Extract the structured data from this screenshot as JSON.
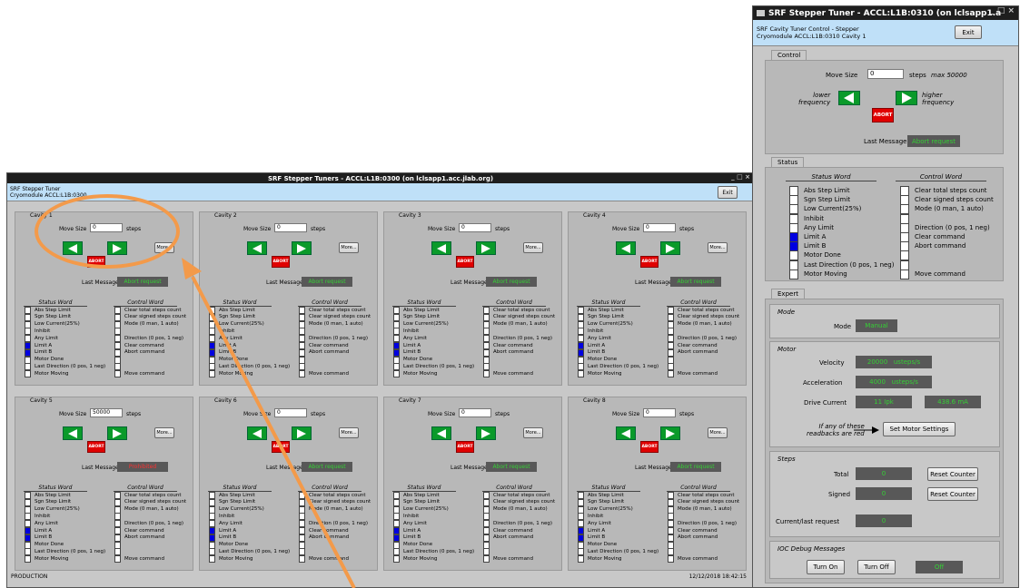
{
  "main_window": {
    "title": "SRF Stepper Tuners - ACCL:L1B:0300 (on lclsapp1.acc.jlab.org)",
    "header_line1": "SRF Stepper Tuner",
    "header_line2": "Cryomodule ACCL:L1B:0300",
    "exit_label": "Exit",
    "footer_left": "PRODUCTION",
    "footer_right": "12/12/2018 18:42:15",
    "window_controls": "_ □ ×",
    "cavities": [
      {
        "name": "Cavity 1",
        "move_size": "0",
        "message": "Abort request",
        "message_state": "ok"
      },
      {
        "name": "Cavity 2",
        "move_size": "0",
        "message": "Abort request",
        "message_state": "ok"
      },
      {
        "name": "Cavity 3",
        "move_size": "0",
        "message": "Abort request",
        "message_state": "ok"
      },
      {
        "name": "Cavity 4",
        "move_size": "0",
        "message": "Abort request",
        "message_state": "ok"
      },
      {
        "name": "Cavity 5",
        "move_size": "50000",
        "message": "Prohibited",
        "message_state": "alarm"
      },
      {
        "name": "Cavity 6",
        "move_size": "0",
        "message": "Abort request",
        "message_state": "ok"
      },
      {
        "name": "Cavity 7",
        "move_size": "0",
        "message": "Abort request",
        "message_state": "ok"
      },
      {
        "name": "Cavity 8",
        "move_size": "0",
        "message": "Abort request",
        "message_state": "ok"
      }
    ]
  },
  "cavity_labels": {
    "move_size": "Move Size",
    "steps": "steps",
    "more": "More...",
    "abort": "ABORT",
    "last_message": "Last Message",
    "status_word": "Status Word",
    "control_word": "Control Word"
  },
  "status_bits": [
    "Abs Step Limit",
    "Sgn Step Limit",
    "Low Current(25%)",
    "Inhibit",
    "Any Limit",
    "Limit A",
    "Limit B",
    "Motor Done",
    "Last Direction (0 pos, 1 neg)",
    "Motor Moving"
  ],
  "status_on": [
    false,
    false,
    false,
    false,
    false,
    true,
    true,
    false,
    false,
    false
  ],
  "control_bits": [
    "Clear total steps count",
    "Clear signed steps count",
    "Mode (0 man, 1 auto)",
    "",
    "Direction (0 pos, 1 neg)",
    "Clear command",
    "Abort command",
    "",
    "",
    "Move command"
  ],
  "detail_window": {
    "title": "SRF Stepper Tuner - ACCL:L1B:0310 (on lclsapp1.a",
    "window_controls": "_ □ ×",
    "header_line1": "SRF Cavity Tuner Control - Stepper",
    "header_line2": "Cryomodule ACCL:L1B:0310 Cavity 1",
    "exit_label": "Exit",
    "control_tab": "Control",
    "move_size_label": "Move Size",
    "move_size": "0",
    "steps": "steps",
    "max_label": "max 50000",
    "lower_label": "lower\nfrequency",
    "higher_label": "higher\nfrequency",
    "abort": "ABORT",
    "last_message_label": "Last Message",
    "last_message": "Abort request",
    "status_tab": "Status",
    "status_word": "Status Word",
    "control_word": "Control Word",
    "expert_tab": "Expert",
    "mode_section": "Mode",
    "mode_label": "Mode",
    "mode_value": "Manual",
    "motor_section": "Motor",
    "velocity_label": "Velocity",
    "velocity_value": "20000",
    "velocity_unit": "usteps/s",
    "accel_label": "Acceleration",
    "accel_value": "4000",
    "accel_unit": "usteps/s",
    "drive_label": "Drive Current",
    "drive_value": "11 Ipk",
    "drive_value2": "438.6 mA",
    "readback_note": "If any of these\nreadbacks are red",
    "set_motor_label": "Set Motor Settings",
    "steps_section": "Steps",
    "total_label": "Total",
    "total_value": "0",
    "reset_counter": "Reset Counter",
    "signed_label": "Signed",
    "signed_value": "0",
    "current_request_label": "Current/last request",
    "current_request_value": "0",
    "ioc_section": "IOC Debug Messages",
    "turn_on": "Turn On",
    "turn_off": "Turn Off",
    "debug_state": "Off"
  },
  "colors": {
    "accent_green": "#0a9a2a",
    "abort_red": "#e00000",
    "status_blue": "#0000e0",
    "readback_green": "#35d035",
    "annotation_orange": "#f39a4a"
  }
}
